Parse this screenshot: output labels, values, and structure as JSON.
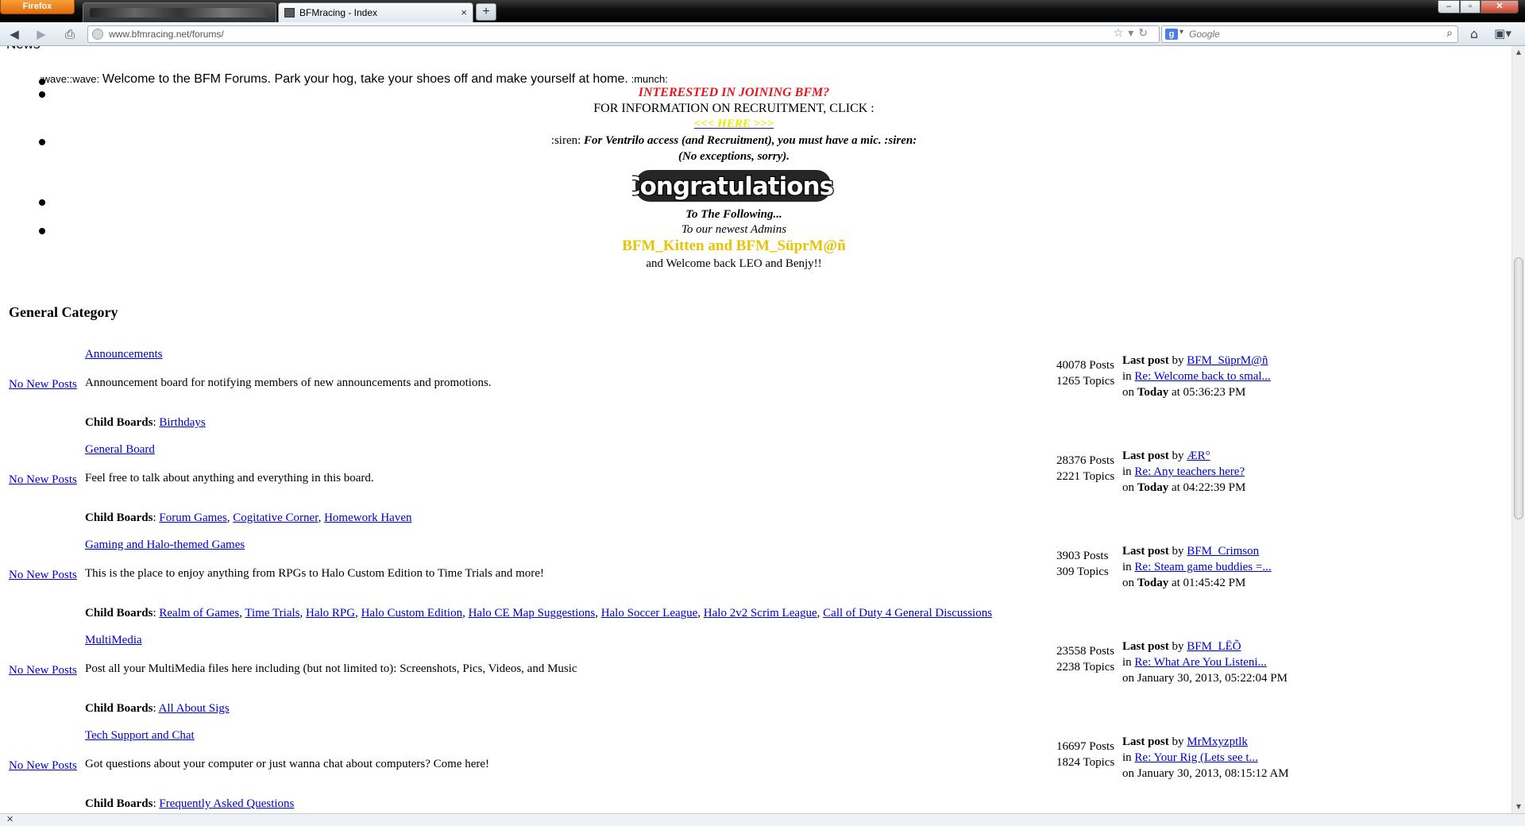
{
  "browser": {
    "menu_label": "Firefox",
    "tabs": [
      {
        "title": ""
      },
      {
        "title": "BFMracing - Index",
        "close": "×"
      }
    ],
    "new_tab": "+",
    "url": "www.bfmracing.net/forums/",
    "search_placeholder": "Google",
    "window_buttons": {
      "minimize": "–",
      "maximize": "▫",
      "close": "✕"
    }
  },
  "news": {
    "label": "News",
    "items": [
      {
        "prefix": ":wave::wave:",
        "text": "Welcome to the BFM Forums. Park your hog, take your shoes off and make yourself at home.",
        "suffix": ":munch:"
      },
      {
        "heading": "INTERESTED IN JOINING BFM?",
        "line": "FOR INFORMATION ON RECRUITMENT, CLICK :",
        "link": "<<< HERE >>>"
      },
      {
        "prefix": ":siren:",
        "text": "For Ventrilo access (and Recruitment), you must have a mic.",
        "suffix": ":siren:",
        "line2": "(No exceptions, sorry)."
      },
      {
        "banner": "Congratulations!",
        "line": "To The Following..."
      },
      {
        "line": "To our newest Admins",
        "names": "BFM_Kitten and BFM_SüprM@ñ",
        "line2": "and Welcome back LEO and Benjy!!"
      }
    ]
  },
  "category": {
    "title": "General Category",
    "child_label": "Child Boards",
    "last_post_label": "Last post",
    "by_label": "by",
    "in_label": "in",
    "on_label": "on",
    "status_label": "No New Posts",
    "boards": [
      {
        "name": "Announcements",
        "description": "Announcement board for notifying members of new announcements and promotions.",
        "posts": "40078 Posts",
        "topics": "1265 Topics",
        "last_by": "BFM_SüprM@ñ",
        "last_topic": "Re: Welcome back to smal...",
        "last_day": "Today",
        "last_time": "at 05:36:23 PM",
        "children": [
          "Birthdays"
        ]
      },
      {
        "name": "General Board",
        "description": "Feel free to talk about anything and everything in this board.",
        "posts": "28376 Posts",
        "topics": "2221 Topics",
        "last_by": "ÆR°",
        "last_topic": "Re: Any teachers here?",
        "last_day": "Today",
        "last_time": "at 04:22:39 PM",
        "children": [
          "Forum Games",
          "Cogitative Corner",
          "Homework Haven"
        ]
      },
      {
        "name": "Gaming and Halo-themed Games",
        "description": "This is the place to enjoy anything from RPGs to Halo Custom Edition to Time Trials and more!",
        "posts": "3903 Posts",
        "topics": "309 Topics",
        "last_by": "BFM_Crimson",
        "last_topic": "Re: Steam game buddies =...",
        "last_day": "Today",
        "last_time": "at 01:45:42 PM",
        "children": [
          "Realm of Games",
          "Time Trials",
          "Halo RPG",
          "Halo Custom Edition",
          "Halo CE Map Suggestions",
          "Halo Soccer League",
          "Halo 2v2 Scrim League",
          "Call of Duty 4 General Discussions"
        ]
      },
      {
        "name": "MultiMedia",
        "description": "Post all your MultiMedia files here including (but not limited to): Screenshots, Pics, Videos, and Music",
        "posts": "23558 Posts",
        "topics": "2238 Topics",
        "last_by": "BFM_LËÕ",
        "last_topic": "Re: What Are You Listeni...",
        "last_day": "",
        "last_time": "January 30, 2013, 05:22:04 PM",
        "children": [
          "All About Sigs"
        ]
      },
      {
        "name": "Tech Support and Chat",
        "description": "Got questions about your computer or just wanna chat about computers? Come here!",
        "posts": "16697 Posts",
        "topics": "1824 Topics",
        "last_by": "MrMxyzptlk",
        "last_topic": "Re: Your Rig (Lets see t...",
        "last_day": "",
        "last_time": "January 30, 2013, 08:15:12 AM",
        "children": [
          "Frequently Asked Questions"
        ]
      }
    ]
  }
}
